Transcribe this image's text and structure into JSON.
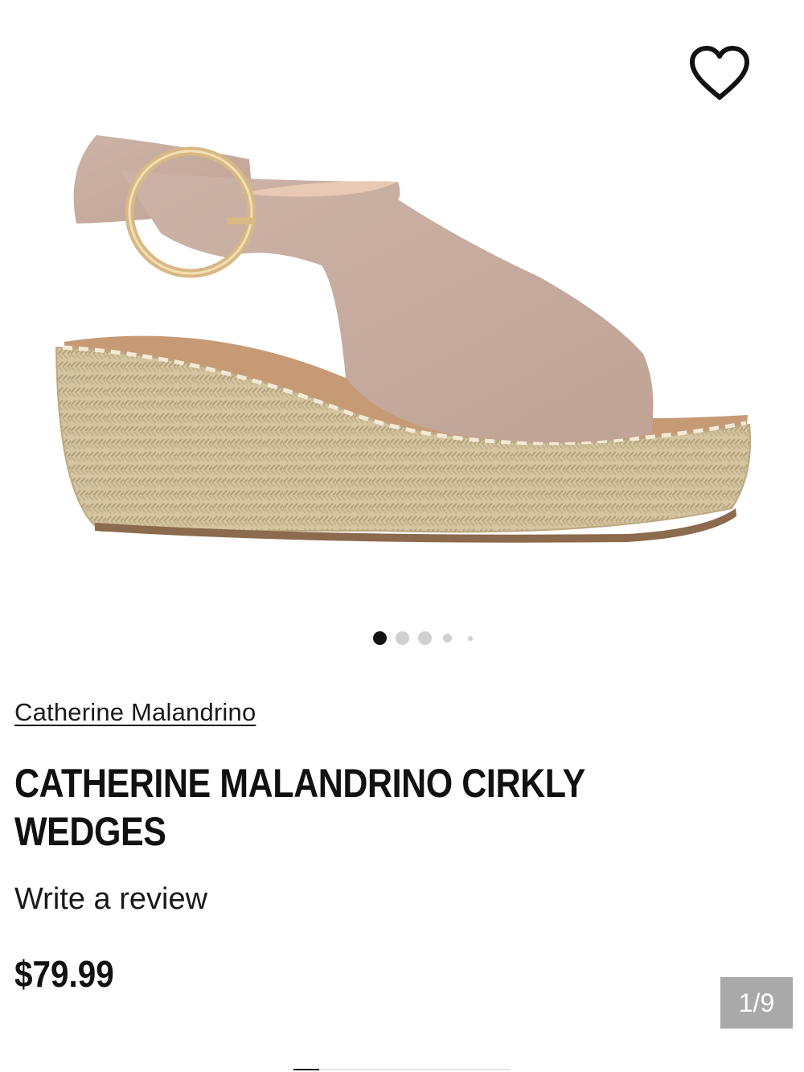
{
  "product": {
    "brand": "Catherine Malandrino",
    "title": "CATHERINE MALANDRINO CIRKLY WEDGES",
    "review_link": "Write a review",
    "price": "$79.99"
  },
  "gallery": {
    "counter": "1/9",
    "current_index": 1,
    "total_images": 9,
    "visible_dots": 5,
    "active_dot": 0
  },
  "icons": {
    "favorite": "heart-outline-icon"
  },
  "colors": {
    "text": "#111111",
    "counter_bg": "#a9a9a9",
    "dot_active": "#111111",
    "dot_inactive": "#d0d0d0",
    "suede": "#c9aea2",
    "jute": "#d2c29d"
  }
}
